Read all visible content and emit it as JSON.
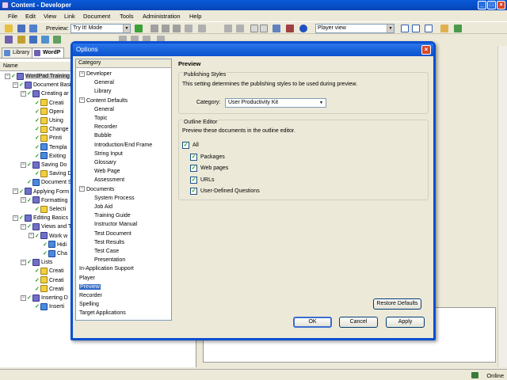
{
  "window": {
    "title": "Content - Developer"
  },
  "menu": [
    "File",
    "Edit",
    "View",
    "Link",
    "Document",
    "Tools",
    "Administration",
    "Help"
  ],
  "toolbar": {
    "preview_label": "Preview:",
    "preview_mode": "Try It! Mode",
    "view_mode": "Player view"
  },
  "left": {
    "tabs": [
      "Library",
      "WordP"
    ],
    "col_name": "Name",
    "tree": [
      "WordPad Training",
      "Document Basi",
      "Creating ar",
      "Creati",
      "Openi",
      "Using",
      "Change",
      "Printi",
      "Templa",
      "Exiting",
      "Saving Do",
      "Saving Do",
      "Document S",
      "Applying Form",
      "Formatting",
      "Selecti",
      "Editing Basics",
      "Views and T",
      "Work w",
      "Hidi",
      "Cha",
      "Lists",
      "Creati",
      "Creati",
      "Creati",
      "Inserting D",
      "Inserti"
    ]
  },
  "dialog": {
    "title": "Options",
    "category_header": "Category",
    "categories": [
      {
        "label": "Developer",
        "expandable": true
      },
      {
        "label": "General"
      },
      {
        "label": "Library"
      },
      {
        "label": "Content Defaults",
        "expandable": true
      },
      {
        "label": "General"
      },
      {
        "label": "Topic"
      },
      {
        "label": "Recorder"
      },
      {
        "label": "Bubble"
      },
      {
        "label": "Introduction/End Frame"
      },
      {
        "label": "String Input"
      },
      {
        "label": "Glossary"
      },
      {
        "label": "Web Page"
      },
      {
        "label": "Assessment"
      },
      {
        "label": "Documents",
        "expandable": true
      },
      {
        "label": "System Process"
      },
      {
        "label": "Job Aid"
      },
      {
        "label": "Training Guide"
      },
      {
        "label": "Instructor Manual"
      },
      {
        "label": "Test Document"
      },
      {
        "label": "Test Results"
      },
      {
        "label": "Test Case"
      },
      {
        "label": "Presentation"
      },
      {
        "label": "In-Application Support"
      },
      {
        "label": "Player"
      },
      {
        "label": "Preview",
        "selected": true
      },
      {
        "label": "Recorder"
      },
      {
        "label": "Spelling"
      },
      {
        "label": "Target Applications"
      }
    ],
    "section_title": "Preview",
    "publishing": {
      "group_title": "Publishing Styles",
      "description": "This setting determines the publishing styles to be used during preview.",
      "category_label": "Category:",
      "category_value": "User Productivity Kit"
    },
    "outline": {
      "group_title": "Outline Editor",
      "description": "Preview these documents in the outline editor.",
      "all_label": "All",
      "items": [
        "Packages",
        "Web pages",
        "URLs",
        "User-Defined Questions"
      ]
    },
    "buttons": {
      "restore": "Restore Defaults",
      "ok": "OK",
      "cancel": "Cancel",
      "apply": "Apply"
    }
  },
  "status": {
    "online": "Online"
  }
}
